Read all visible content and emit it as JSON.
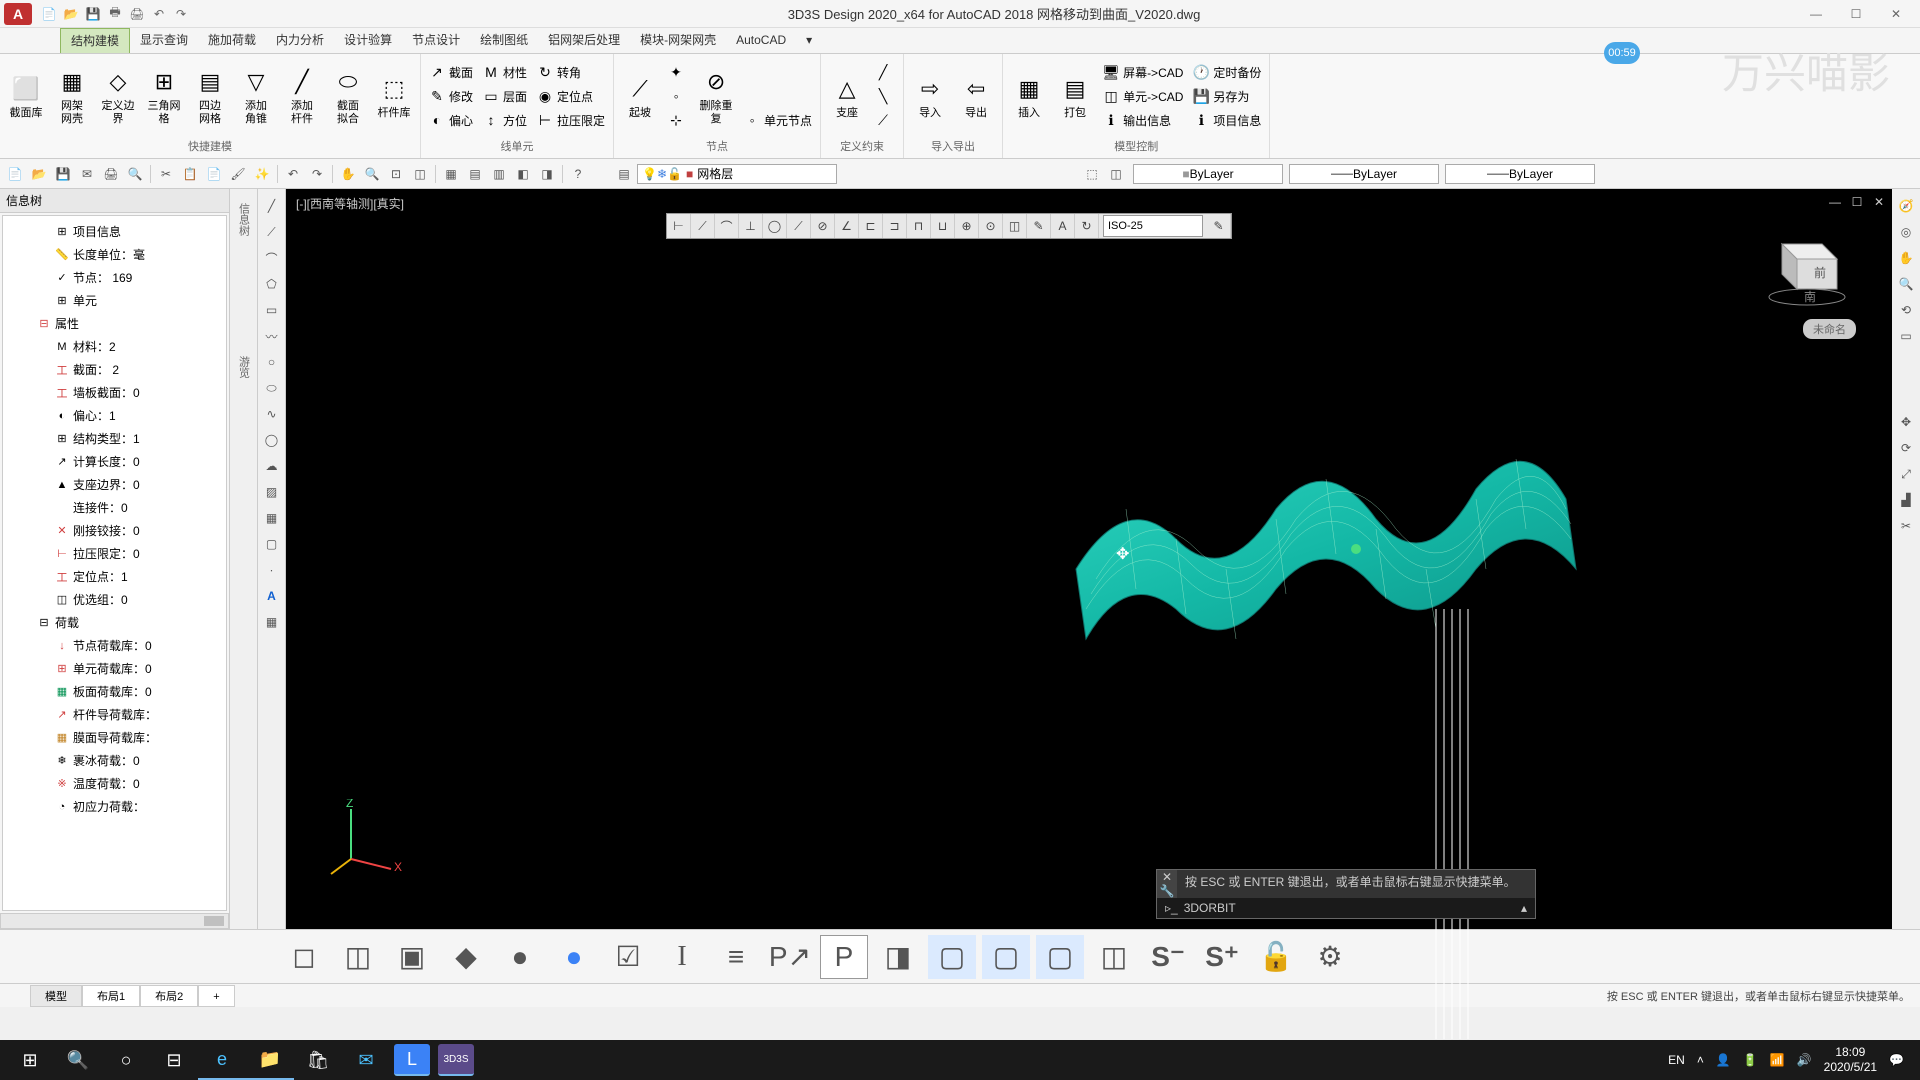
{
  "title": "3D3S Design 2020_x64 for AutoCAD 2018    网格移动到曲面_V2020.dwg",
  "qat": [
    "📄",
    "📂",
    "💾",
    "🖶",
    "🖨",
    "↶",
    "↷"
  ],
  "tabs": [
    "结构建模",
    "显示查询",
    "施加荷载",
    "内力分析",
    "设计验算",
    "节点设计",
    "绘制图纸",
    "铝网架后处理",
    "模块-网架网壳",
    "AutoCAD"
  ],
  "active_tab": 0,
  "ribbon_groups": [
    {
      "label": "快捷建模",
      "items": [
        {
          "type": "big",
          "icon": "⬜",
          "label": "截面库"
        },
        {
          "type": "big",
          "icon": "▦",
          "label": "网架\n网壳"
        },
        {
          "type": "big",
          "icon": "◇",
          "label": "定义边界"
        },
        {
          "type": "big",
          "icon": "⊞",
          "label": "三角网格"
        },
        {
          "type": "big",
          "icon": "▤",
          "label": "四边\n网格"
        },
        {
          "type": "big",
          "icon": "▽",
          "label": "添加\n角锥"
        },
        {
          "type": "big",
          "icon": "╱",
          "label": "添加\n杆件"
        },
        {
          "type": "big",
          "icon": "⬭",
          "label": "截面\n拟合"
        },
        {
          "type": "big",
          "icon": "⬚",
          "label": "杆件库"
        }
      ]
    },
    {
      "label": "线单元",
      "items": [
        {
          "type": "col",
          "rows": [
            {
              "icon": "↗",
              "label": "截面"
            },
            {
              "icon": "✎",
              "label": "修改"
            },
            {
              "icon": "◐",
              "label": "偏心"
            }
          ]
        },
        {
          "type": "col",
          "rows": [
            {
              "icon": "M",
              "label": "材性"
            },
            {
              "icon": "▭",
              "label": "层面"
            },
            {
              "icon": "↕",
              "label": "方位"
            }
          ]
        },
        {
          "type": "col",
          "rows": [
            {
              "icon": "↻",
              "label": "转角"
            },
            {
              "icon": "◉",
              "label": "定位点"
            },
            {
              "icon": "⊢",
              "label": "拉压限定"
            }
          ]
        }
      ]
    },
    {
      "label": "节点",
      "items": [
        {
          "type": "big",
          "icon": "⟋",
          "label": "起坡"
        },
        {
          "type": "col",
          "rows": [
            {
              "icon": "✦",
              "label": ""
            },
            {
              "icon": "◦",
              "label": ""
            },
            {
              "icon": "⊹",
              "label": ""
            }
          ]
        },
        {
          "type": "big",
          "icon": "⊘",
          "label": "删除重复"
        },
        {
          "type": "col",
          "rows": [
            {
              "icon": "",
              "label": ""
            },
            {
              "icon": "",
              "label": ""
            },
            {
              "icon": "◦",
              "label": "单元节点"
            }
          ]
        }
      ]
    },
    {
      "label": "定义约束",
      "items": [
        {
          "type": "big",
          "icon": "△",
          "label": "支座"
        },
        {
          "type": "col",
          "rows": [
            {
              "icon": "╱",
              "label": ""
            },
            {
              "icon": "╲",
              "label": ""
            },
            {
              "icon": "⟋",
              "label": ""
            }
          ]
        }
      ]
    },
    {
      "label": "导入导出",
      "items": [
        {
          "type": "big",
          "icon": "⇨",
          "label": "导入"
        },
        {
          "type": "big",
          "icon": "⇦",
          "label": "导出"
        }
      ]
    },
    {
      "label": "模型控制",
      "items": [
        {
          "type": "big",
          "icon": "▦",
          "label": "插入"
        },
        {
          "type": "big",
          "icon": "▤",
          "label": "打包"
        },
        {
          "type": "col",
          "rows": [
            {
              "icon": "🖥",
              "label": "屏幕->CAD"
            },
            {
              "icon": "◫",
              "label": "单元->CAD"
            },
            {
              "icon": "ℹ",
              "label": "输出信息"
            }
          ]
        },
        {
          "type": "col",
          "rows": [
            {
              "icon": "🕐",
              "label": "定时备份"
            },
            {
              "icon": "💾",
              "label": "另存为"
            },
            {
              "icon": "ℹ",
              "label": "项目信息"
            }
          ]
        }
      ]
    }
  ],
  "layer_name": "网格层",
  "bylayer": "ByLayer",
  "info_panel_title": "信息树",
  "tree": [
    {
      "l": 1,
      "icon": "⊞",
      "label": "项目信息"
    },
    {
      "l": 1,
      "icon": "📏",
      "label": "长度单位：毫"
    },
    {
      "l": 1,
      "icon": "✓",
      "label": "节点： 169"
    },
    {
      "l": 1,
      "icon": "⊞",
      "label": "单元"
    },
    {
      "l": 0,
      "icon": "⊟",
      "label": "属性",
      "color": "#d04040"
    },
    {
      "l": 1,
      "icon": "M",
      "label": "材料：2"
    },
    {
      "l": 1,
      "icon": "工",
      "label": "截面： 2",
      "color": "#d04040"
    },
    {
      "l": 1,
      "icon": "工",
      "label": "墙板截面：0",
      "color": "#d04040"
    },
    {
      "l": 1,
      "icon": "◐",
      "label": "偏心：1"
    },
    {
      "l": 1,
      "icon": "⊞",
      "label": "结构类型：1"
    },
    {
      "l": 1,
      "icon": "↗",
      "label": "计算长度：0"
    },
    {
      "l": 1,
      "icon": "▲",
      "label": "支座边界：0"
    },
    {
      "l": 1,
      "icon": "",
      "label": "连接件：0"
    },
    {
      "l": 1,
      "icon": "✕",
      "label": "刚接铰接：0",
      "color": "#d04040"
    },
    {
      "l": 1,
      "icon": "⊢",
      "label": "拉压限定：0",
      "color": "#d04040"
    },
    {
      "l": 1,
      "icon": "工",
      "label": "定位点：1",
      "color": "#d04040"
    },
    {
      "l": 1,
      "icon": "◫",
      "label": "优选组：0"
    },
    {
      "l": 0,
      "icon": "⊟",
      "label": "荷载"
    },
    {
      "l": 1,
      "icon": "↓",
      "label": "节点荷载库：0",
      "color": "#d04040"
    },
    {
      "l": 1,
      "icon": "⊞",
      "label": "单元荷载库：0",
      "color": "#d04040"
    },
    {
      "l": 1,
      "icon": "▦",
      "label": "板面荷载库：0",
      "color": "#009050"
    },
    {
      "l": 1,
      "icon": "↗",
      "label": "杆件导荷载库：",
      "color": "#d04040"
    },
    {
      "l": 1,
      "icon": "▦",
      "label": "膜面导荷载库：",
      "color": "#c08020"
    },
    {
      "l": 1,
      "icon": "❄",
      "label": "裹冰荷载：0"
    },
    {
      "l": 1,
      "icon": "※",
      "label": "温度荷载：0",
      "color": "#d04040"
    },
    {
      "l": 1,
      "icon": "◔",
      "label": "初应力荷载："
    }
  ],
  "vert_labels": [
    "信息树",
    "游览"
  ],
  "viewport_title": "[-][西南等轴测][真实]",
  "dim_style": "ISO-25",
  "cmd_hint": "按 ESC 或 ENTER 键退出，或者单击鼠标右键显示快捷菜单。",
  "cmd_current": "3DORBIT",
  "viewcube_face": "前",
  "viewcube_label": "未命名",
  "sheet_tabs": [
    "模型",
    "布局1",
    "布局2"
  ],
  "status_hint": "按 ESC 或 ENTER 键退出，或者单击鼠标右键显示快捷菜单。",
  "watermark": "万兴喵影",
  "timer": "00:59",
  "tray_lang": "EN",
  "clock_time": "18:09",
  "clock_date": "2020/5/21"
}
